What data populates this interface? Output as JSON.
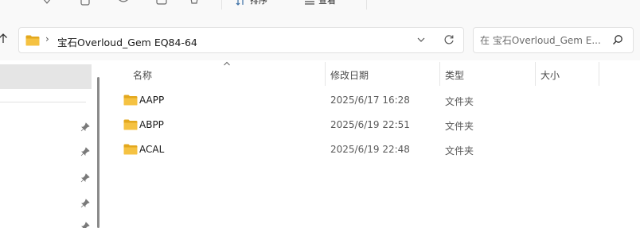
{
  "toolbar": {
    "sort_label": "排序",
    "view_label": "查看"
  },
  "address": {
    "path": "宝石Overloud_Gem EQ84-64"
  },
  "search": {
    "placeholder": "在 宝石Overloud_Gem E..."
  },
  "columns": {
    "name": "名称",
    "date": "修改日期",
    "type": "类型",
    "size": "大小"
  },
  "files": [
    {
      "name": "AAPP",
      "date": "2025/6/17 16:28",
      "type": "文件夹"
    },
    {
      "name": "ABPP",
      "date": "2025/6/19 22:51",
      "type": "文件夹"
    },
    {
      "name": "ACAL",
      "date": "2025/6/19 22:48",
      "type": "文件夹"
    }
  ],
  "colors": {
    "folder_yellow": "#f5c242",
    "folder_back": "#e3a81e",
    "selection": "#e5e5e5",
    "border": "#e1e1e1"
  }
}
